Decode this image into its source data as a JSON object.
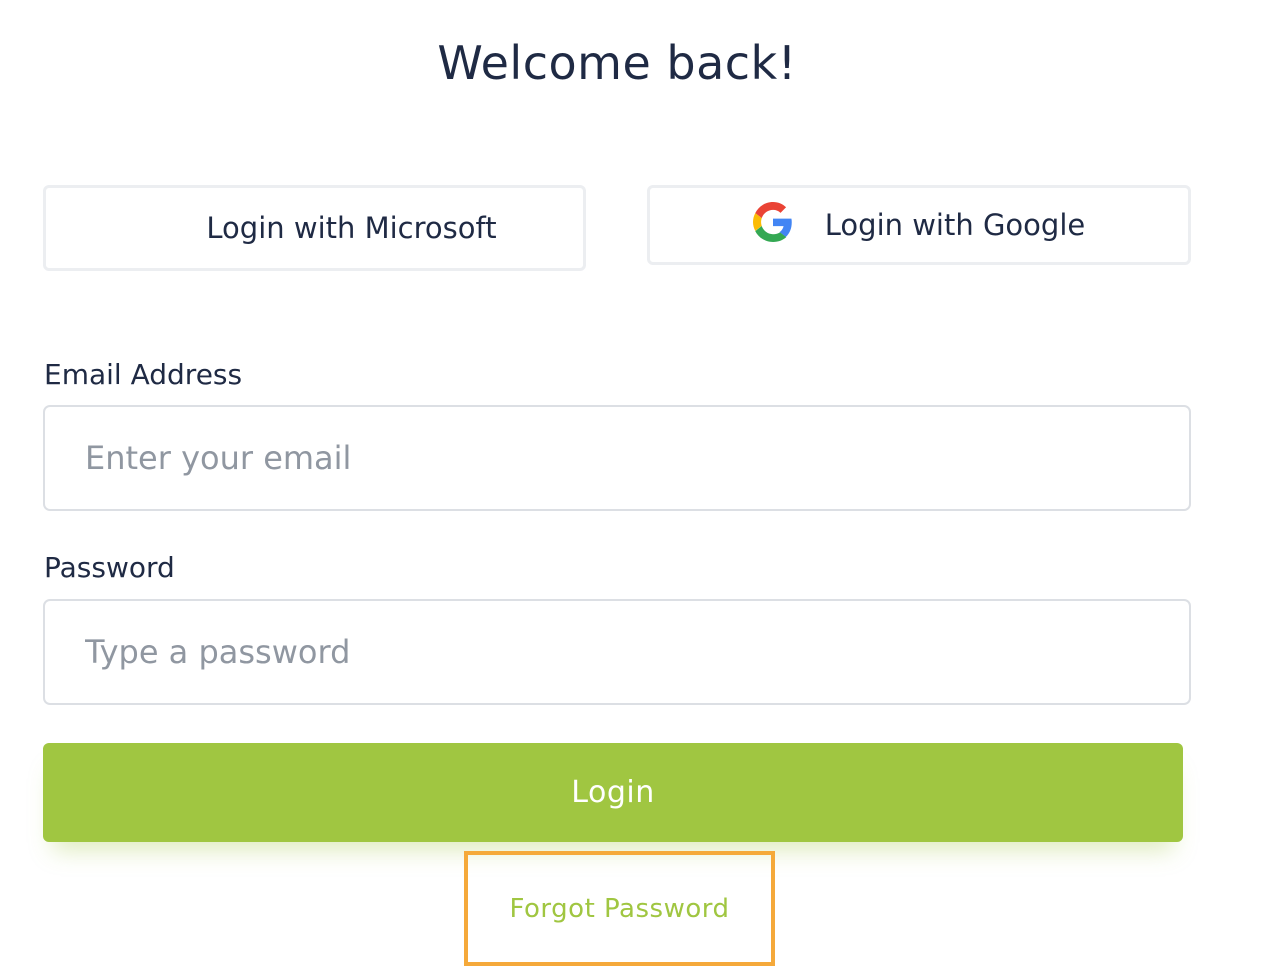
{
  "header": {
    "title": "Welcome back!"
  },
  "sso": {
    "microsoft": {
      "label": "Login with Microsoft",
      "icon": "microsoft-logo-icon",
      "colors": [
        "#f25022",
        "#7fba00",
        "#00a4ef",
        "#ffb900"
      ]
    },
    "google": {
      "label": "Login with Google",
      "icon": "google-logo-icon",
      "colors": [
        "#4285f4",
        "#34a853",
        "#fbbc05",
        "#ea4335"
      ]
    }
  },
  "form": {
    "email": {
      "label": "Email Address",
      "placeholder": "Enter your email",
      "value": ""
    },
    "password": {
      "label": "Password",
      "placeholder": "Type a password",
      "value": ""
    },
    "submit_label": "Login"
  },
  "links": {
    "forgot_password": "Forgot Password"
  },
  "colors": {
    "accent": "#a0c641",
    "highlight": "#f5a93a",
    "text": "#1f2a44",
    "placeholder": "#9097a1",
    "border": "#dcdfe4"
  }
}
